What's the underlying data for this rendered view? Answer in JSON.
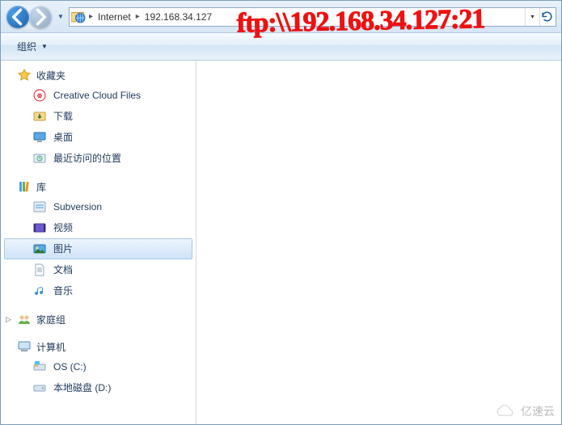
{
  "nav": {
    "back_enabled": true,
    "forward_enabled": false
  },
  "breadcrumb": {
    "root_icon": "globe-folder",
    "items": [
      "Internet",
      "192.168.34.127"
    ]
  },
  "toolbar": {
    "organize_label": "组织"
  },
  "sidebar": {
    "groups": [
      {
        "icon": "star",
        "label": "收藏夹",
        "expanded": true,
        "items": [
          {
            "icon": "cc",
            "label": "Creative Cloud Files"
          },
          {
            "icon": "downloads",
            "label": "下载"
          },
          {
            "icon": "desktop",
            "label": "桌面"
          },
          {
            "icon": "recent",
            "label": "最近访问的位置"
          }
        ]
      },
      {
        "icon": "library",
        "label": "库",
        "expanded": true,
        "items": [
          {
            "icon": "svn",
            "label": "Subversion"
          },
          {
            "icon": "video",
            "label": "视频"
          },
          {
            "icon": "pictures",
            "label": "图片",
            "selected": true
          },
          {
            "icon": "documents",
            "label": "文档"
          },
          {
            "icon": "music",
            "label": "音乐"
          }
        ]
      },
      {
        "icon": "homegroup",
        "label": "家庭组",
        "expanded": false,
        "items": []
      },
      {
        "icon": "computer",
        "label": "计算机",
        "expanded": true,
        "items": [
          {
            "icon": "drive-os",
            "label": "OS (C:)"
          },
          {
            "icon": "drive",
            "label": "本地磁盘 (D:)"
          }
        ]
      }
    ]
  },
  "content": {
    "empty": true
  },
  "annotation": {
    "handwritten_text": "ftp:\\\\192.168.34.127:21"
  },
  "watermark": {
    "text": "亿速云"
  }
}
